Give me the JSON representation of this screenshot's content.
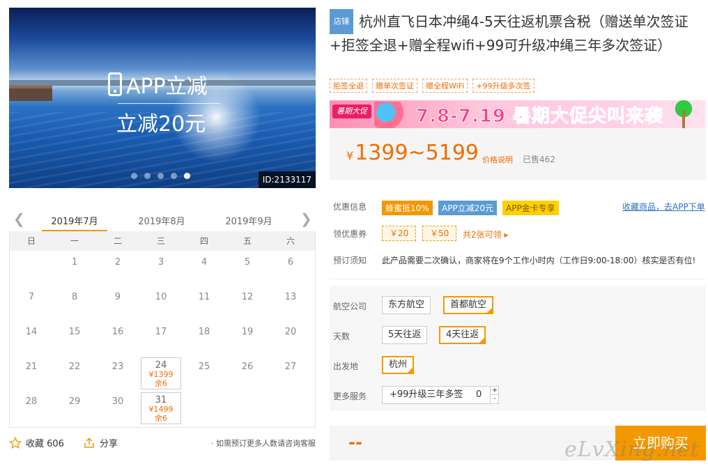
{
  "hero": {
    "promo_line1": "APP立减",
    "promo_line2": "立减20元",
    "id_label": "ID:2133117",
    "slide_count": 5,
    "active_slide": 5
  },
  "calendar": {
    "tabs": [
      "2019年7月",
      "2019年8月",
      "2019年9月"
    ],
    "active_tab": 0,
    "weekdays": [
      "日",
      "一",
      "二",
      "三",
      "四",
      "五",
      "六"
    ],
    "days": [
      {
        "d": ""
      },
      {
        "d": "1"
      },
      {
        "d": "2"
      },
      {
        "d": "3"
      },
      {
        "d": "4"
      },
      {
        "d": "5"
      },
      {
        "d": "6"
      },
      {
        "d": "7"
      },
      {
        "d": "8"
      },
      {
        "d": "9"
      },
      {
        "d": "10"
      },
      {
        "d": "11"
      },
      {
        "d": "12"
      },
      {
        "d": "13"
      },
      {
        "d": "14"
      },
      {
        "d": "15"
      },
      {
        "d": "16"
      },
      {
        "d": "17"
      },
      {
        "d": "18"
      },
      {
        "d": "19"
      },
      {
        "d": "20"
      },
      {
        "d": "21"
      },
      {
        "d": "22"
      },
      {
        "d": "23"
      },
      {
        "d": "24",
        "price": "¥1399",
        "stock": "余6"
      },
      {
        "d": "25"
      },
      {
        "d": "26"
      },
      {
        "d": "27"
      },
      {
        "d": "28"
      },
      {
        "d": "29"
      },
      {
        "d": "30"
      },
      {
        "d": "31",
        "price": "¥1499",
        "stock": "余6"
      }
    ]
  },
  "footer_left": {
    "favorite": "收藏 606",
    "share": "分享",
    "note": "· 如需预订更多人数请咨询客服"
  },
  "product": {
    "badge": "店铺",
    "title": "杭州直飞日本冲绳4-5天往返机票含税（赠送单次签证+拒签全退+赠全程wifi+99可升级冲绳三年多次签证）",
    "tags": [
      "拒签全退",
      "赠单次签证",
      "赠全程WiFi",
      "+99升级多次签"
    ]
  },
  "banner": {
    "logo": "暑期大促",
    "text": "7.8-7.19 暑期大促尖叫来袭"
  },
  "price": {
    "currency": "¥",
    "range": "1399~5199",
    "explain": "价格说明",
    "sold": "已售462"
  },
  "promo": {
    "label": "优惠信息",
    "chips": [
      "蜂蜜抵10%",
      "APP立减20元",
      "APP金卡专享"
    ],
    "link": "收藏商品，去APP下单"
  },
  "coupons": {
    "label": "领优惠券",
    "items": [
      "￥20",
      "￥50"
    ],
    "more": "共2张可领 ▸"
  },
  "notice": {
    "label": "预订须知",
    "text": "此产品需要二次确认，商家将在9个工作小时内（工作日9:00-18:00）核实是否有位!"
  },
  "options": {
    "airline": {
      "label": "航空公司",
      "values": [
        "东方航空",
        "首都航空"
      ],
      "selected": 1
    },
    "days": {
      "label": "天数",
      "values": [
        "5天往返",
        "4天往返"
      ],
      "selected": 1
    },
    "departure": {
      "label": "出发地",
      "values": [
        "杭州"
      ],
      "selected": 0
    },
    "services": {
      "label": "更多服务",
      "item": "+99升级三年多签",
      "qty": "0",
      "plus": "+",
      "minus": "-"
    }
  },
  "buy": {
    "total": "--",
    "button": "立即购买"
  },
  "watermark": "eLvXing.net",
  "colors": {
    "accent": "#f39800",
    "price": "#f06d00",
    "link": "#2a6fc9",
    "badge": "#5b9bd5"
  }
}
